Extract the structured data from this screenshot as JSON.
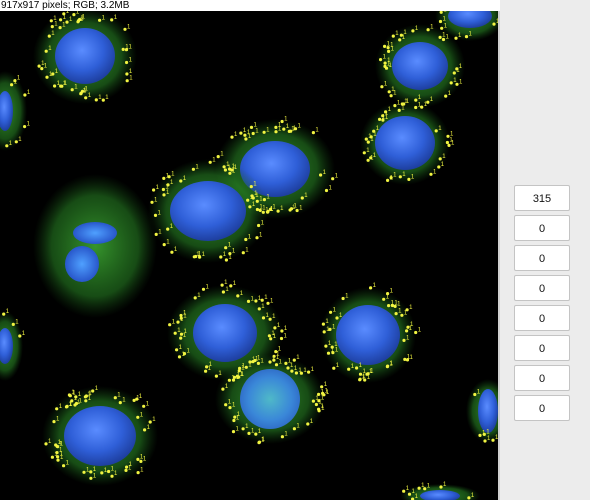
{
  "image_window": {
    "info": "917x917 pixels; RGB; 3.2MB",
    "image_description_icon": "fluorescence-microscopy-image",
    "marker_label": "1"
  },
  "counter_panel": {
    "fields": [
      "315",
      "0",
      "0",
      "0",
      "0",
      "0",
      "0",
      "0"
    ]
  },
  "colors": {
    "nucleus": "#2f63e0",
    "cytoplasm": "#2f9a2a",
    "marker": "#f2f542",
    "background": "#000000"
  }
}
